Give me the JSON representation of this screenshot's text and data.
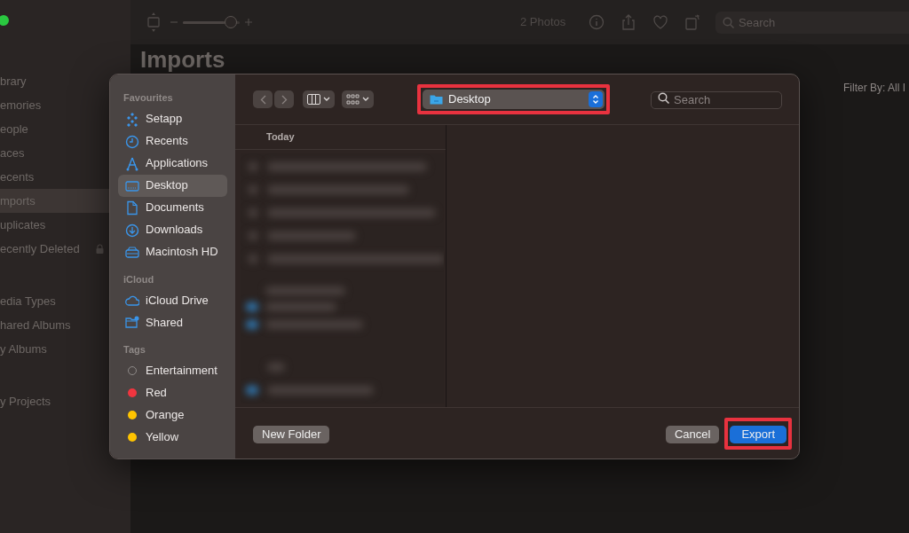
{
  "app": {
    "toolbar": {
      "zoom_slider": {
        "level": 0.93
      },
      "photo_count": "2 Photos",
      "search": {
        "placeholder": "Search"
      }
    },
    "sidebar": {
      "groups": [
        {
          "items": [
            {
              "label": "brary",
              "selected": false,
              "locked": false
            },
            {
              "label": "emories",
              "selected": false,
              "locked": false
            },
            {
              "label": "eople",
              "selected": false,
              "locked": false
            },
            {
              "label": "aces",
              "selected": false,
              "locked": false
            },
            {
              "label": "ecents",
              "selected": false,
              "locked": false
            },
            {
              "label": "mports",
              "selected": true,
              "locked": false
            },
            {
              "label": "uplicates",
              "selected": false,
              "locked": false
            },
            {
              "label": "ecently Deleted",
              "selected": false,
              "locked": true
            }
          ]
        },
        {
          "items": [
            {
              "label": "edia Types",
              "selected": false,
              "locked": false
            },
            {
              "label": "hared Albums",
              "selected": false,
              "locked": false
            },
            {
              "label": "y Albums",
              "selected": false,
              "locked": false
            }
          ]
        },
        {
          "items": [
            {
              "label": "y Projects",
              "selected": false,
              "locked": false
            }
          ]
        }
      ]
    },
    "title": "Imports",
    "filter": "Filter By: All I"
  },
  "dialog": {
    "toolbar": {
      "path_popup": {
        "label": "Desktop",
        "highlighted": true
      },
      "search": {
        "placeholder": "Search"
      }
    },
    "sidebar": {
      "sections": [
        {
          "heading": "Favourites",
          "kind": "places",
          "items": [
            {
              "label": "Setapp",
              "selected": false
            },
            {
              "label": "Recents",
              "selected": false
            },
            {
              "label": "Applications",
              "selected": false
            },
            {
              "label": "Desktop",
              "selected": true
            },
            {
              "label": "Documents",
              "selected": false
            },
            {
              "label": "Downloads",
              "selected": false
            },
            {
              "label": "Macintosh HD",
              "selected": false
            }
          ]
        },
        {
          "heading": "iCloud",
          "kind": "cloud",
          "items": [
            {
              "label": "iCloud Drive",
              "selected": false
            },
            {
              "label": "Shared",
              "selected": false
            }
          ]
        },
        {
          "heading": "Tags",
          "kind": "tags",
          "items": [
            {
              "label": "Entertainment",
              "selected": false,
              "color": "#8e8a88",
              "filled": false
            },
            {
              "label": "Red",
              "selected": false,
              "color": "#f0353f",
              "filled": true
            },
            {
              "label": "Orange",
              "selected": false,
              "color": "#ffc400",
              "filled": true
            },
            {
              "label": "Yellow",
              "selected": false,
              "color": "#ffc400",
              "filled": true
            }
          ]
        }
      ]
    },
    "browser": {
      "column_header": "Today"
    },
    "buttons": [
      {
        "label": "New Folder",
        "kind": "plain",
        "highlighted": false
      },
      {
        "label": "Cancel",
        "kind": "plain",
        "highlighted": false
      },
      {
        "label": "Export",
        "kind": "primary",
        "highlighted": true
      }
    ]
  }
}
